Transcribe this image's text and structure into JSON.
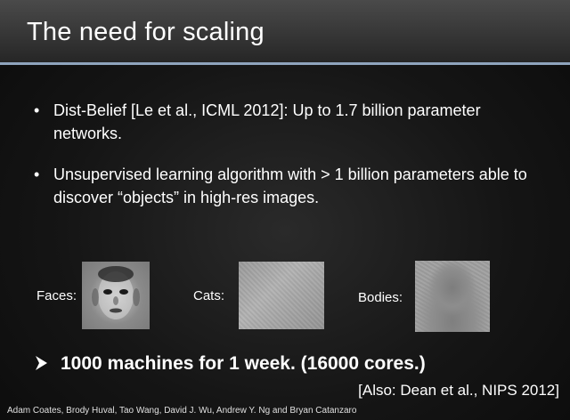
{
  "slide": {
    "title": "The need for scaling",
    "bullets": [
      {
        "symbol": "•",
        "text": "Dist-Belief [Le et al., ICML 2012]:  Up to 1.7 billion parameter networks."
      },
      {
        "symbol": "•",
        "text": "Unsupervised learning algorithm with > 1 billion parameters able to discover “objects” in high-res images."
      }
    ],
    "images": {
      "faces_label": "Faces:",
      "cats_label": "Cats:",
      "bodies_label": "Bodies:"
    },
    "highlight": "1000 machines for 1 week.  (16000 cores.)",
    "reference": "[Also:  Dean et al., NIPS 2012]",
    "footer": "Adam Coates, Brody Huval, Tao Wang, David J. Wu, Andrew Y. Ng and Bryan Catanzaro",
    "colors": {
      "background": "#121212",
      "title_bar": "#3a3a3a",
      "title_rule": "#8fa4bd",
      "text": "#ffffff"
    }
  }
}
